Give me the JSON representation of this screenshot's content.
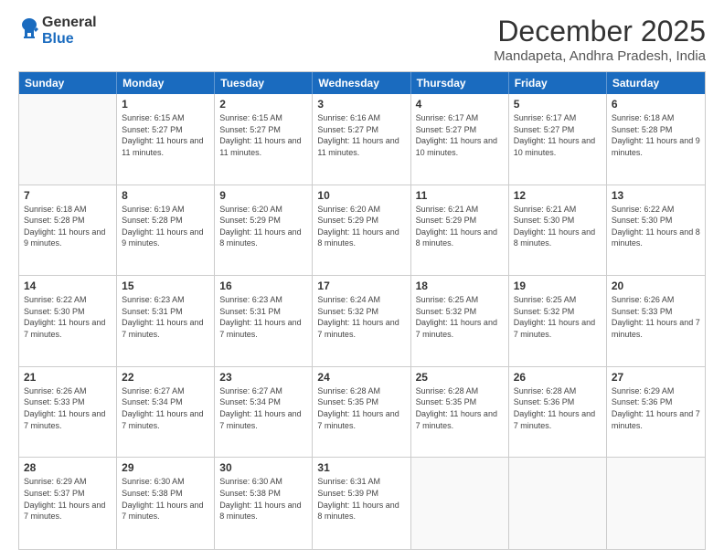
{
  "logo": {
    "general": "General",
    "blue": "Blue"
  },
  "title": "December 2025",
  "location": "Mandapeta, Andhra Pradesh, India",
  "header_days": [
    "Sunday",
    "Monday",
    "Tuesday",
    "Wednesday",
    "Thursday",
    "Friday",
    "Saturday"
  ],
  "weeks": [
    [
      {
        "day": "",
        "empty": true
      },
      {
        "day": "1",
        "sunrise": "6:15 AM",
        "sunset": "5:27 PM",
        "daylight": "11 hours and 11 minutes."
      },
      {
        "day": "2",
        "sunrise": "6:15 AM",
        "sunset": "5:27 PM",
        "daylight": "11 hours and 11 minutes."
      },
      {
        "day": "3",
        "sunrise": "6:16 AM",
        "sunset": "5:27 PM",
        "daylight": "11 hours and 11 minutes."
      },
      {
        "day": "4",
        "sunrise": "6:17 AM",
        "sunset": "5:27 PM",
        "daylight": "11 hours and 10 minutes."
      },
      {
        "day": "5",
        "sunrise": "6:17 AM",
        "sunset": "5:27 PM",
        "daylight": "11 hours and 10 minutes."
      },
      {
        "day": "6",
        "sunrise": "6:18 AM",
        "sunset": "5:28 PM",
        "daylight": "11 hours and 9 minutes."
      }
    ],
    [
      {
        "day": "7",
        "sunrise": "6:18 AM",
        "sunset": "5:28 PM",
        "daylight": "11 hours and 9 minutes."
      },
      {
        "day": "8",
        "sunrise": "6:19 AM",
        "sunset": "5:28 PM",
        "daylight": "11 hours and 9 minutes."
      },
      {
        "day": "9",
        "sunrise": "6:20 AM",
        "sunset": "5:29 PM",
        "daylight": "11 hours and 8 minutes."
      },
      {
        "day": "10",
        "sunrise": "6:20 AM",
        "sunset": "5:29 PM",
        "daylight": "11 hours and 8 minutes."
      },
      {
        "day": "11",
        "sunrise": "6:21 AM",
        "sunset": "5:29 PM",
        "daylight": "11 hours and 8 minutes."
      },
      {
        "day": "12",
        "sunrise": "6:21 AM",
        "sunset": "5:30 PM",
        "daylight": "11 hours and 8 minutes."
      },
      {
        "day": "13",
        "sunrise": "6:22 AM",
        "sunset": "5:30 PM",
        "daylight": "11 hours and 8 minutes."
      }
    ],
    [
      {
        "day": "14",
        "sunrise": "6:22 AM",
        "sunset": "5:30 PM",
        "daylight": "11 hours and 7 minutes."
      },
      {
        "day": "15",
        "sunrise": "6:23 AM",
        "sunset": "5:31 PM",
        "daylight": "11 hours and 7 minutes."
      },
      {
        "day": "16",
        "sunrise": "6:23 AM",
        "sunset": "5:31 PM",
        "daylight": "11 hours and 7 minutes."
      },
      {
        "day": "17",
        "sunrise": "6:24 AM",
        "sunset": "5:32 PM",
        "daylight": "11 hours and 7 minutes."
      },
      {
        "day": "18",
        "sunrise": "6:25 AM",
        "sunset": "5:32 PM",
        "daylight": "11 hours and 7 minutes."
      },
      {
        "day": "19",
        "sunrise": "6:25 AM",
        "sunset": "5:32 PM",
        "daylight": "11 hours and 7 minutes."
      },
      {
        "day": "20",
        "sunrise": "6:26 AM",
        "sunset": "5:33 PM",
        "daylight": "11 hours and 7 minutes."
      }
    ],
    [
      {
        "day": "21",
        "sunrise": "6:26 AM",
        "sunset": "5:33 PM",
        "daylight": "11 hours and 7 minutes."
      },
      {
        "day": "22",
        "sunrise": "6:27 AM",
        "sunset": "5:34 PM",
        "daylight": "11 hours and 7 minutes."
      },
      {
        "day": "23",
        "sunrise": "6:27 AM",
        "sunset": "5:34 PM",
        "daylight": "11 hours and 7 minutes."
      },
      {
        "day": "24",
        "sunrise": "6:28 AM",
        "sunset": "5:35 PM",
        "daylight": "11 hours and 7 minutes."
      },
      {
        "day": "25",
        "sunrise": "6:28 AM",
        "sunset": "5:35 PM",
        "daylight": "11 hours and 7 minutes."
      },
      {
        "day": "26",
        "sunrise": "6:28 AM",
        "sunset": "5:36 PM",
        "daylight": "11 hours and 7 minutes."
      },
      {
        "day": "27",
        "sunrise": "6:29 AM",
        "sunset": "5:36 PM",
        "daylight": "11 hours and 7 minutes."
      }
    ],
    [
      {
        "day": "28",
        "sunrise": "6:29 AM",
        "sunset": "5:37 PM",
        "daylight": "11 hours and 7 minutes."
      },
      {
        "day": "29",
        "sunrise": "6:30 AM",
        "sunset": "5:38 PM",
        "daylight": "11 hours and 7 minutes."
      },
      {
        "day": "30",
        "sunrise": "6:30 AM",
        "sunset": "5:38 PM",
        "daylight": "11 hours and 8 minutes."
      },
      {
        "day": "31",
        "sunrise": "6:31 AM",
        "sunset": "5:39 PM",
        "daylight": "11 hours and 8 minutes."
      },
      {
        "day": "",
        "empty": true
      },
      {
        "day": "",
        "empty": true
      },
      {
        "day": "",
        "empty": true
      }
    ]
  ]
}
